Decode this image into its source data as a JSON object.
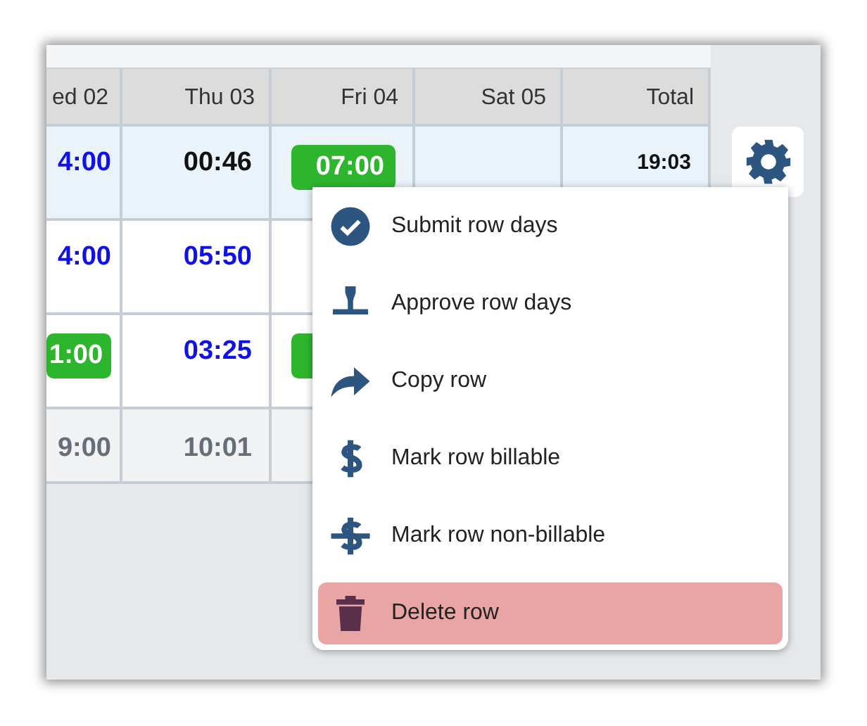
{
  "table": {
    "columns": [
      "ed 02",
      "Thu 03",
      "Fri 04",
      "Sat 05",
      "Total"
    ],
    "rows": [
      {
        "highlighted": true,
        "cells": [
          {
            "kind": "blue",
            "text": "4:00"
          },
          {
            "kind": "plain",
            "text": "00:46"
          },
          {
            "kind": "green",
            "text": "07:00"
          },
          {
            "kind": "empty"
          },
          {
            "kind": "total",
            "text": "19:03"
          }
        ]
      },
      {
        "highlighted": false,
        "cells": [
          {
            "kind": "blue",
            "text": "4:00"
          },
          {
            "kind": "blue",
            "text": "05:50"
          },
          {
            "kind": "empty"
          },
          {
            "kind": "empty"
          },
          {
            "kind": "empty"
          }
        ]
      },
      {
        "highlighted": false,
        "cells": [
          {
            "kind": "green",
            "text": "1:00"
          },
          {
            "kind": "blue",
            "text": "03:25"
          },
          {
            "kind": "green"
          },
          {
            "kind": "empty"
          },
          {
            "kind": "empty"
          }
        ]
      }
    ],
    "totals": [
      "9:00",
      "10:01"
    ]
  },
  "menu": {
    "items": [
      {
        "kind": "check",
        "label": "Submit row days",
        "selected": false
      },
      {
        "kind": "stamp",
        "label": "Approve row days",
        "selected": false
      },
      {
        "kind": "share",
        "label": "Copy row",
        "selected": false
      },
      {
        "kind": "dollar",
        "label": "Mark row billable",
        "selected": false
      },
      {
        "kind": "nodollar",
        "label": "Mark row non-billable",
        "selected": false
      },
      {
        "kind": "trash",
        "label": "Delete row",
        "selected": true
      }
    ]
  }
}
